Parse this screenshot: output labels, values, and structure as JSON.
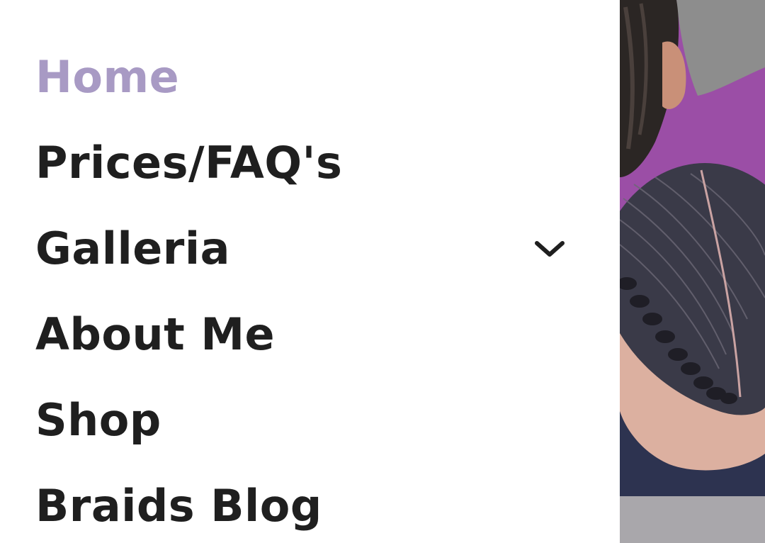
{
  "nav": {
    "items": [
      {
        "label": "Home",
        "active": true
      },
      {
        "label": "Prices/FAQ's"
      },
      {
        "label": "Galleria",
        "has_submenu": true
      },
      {
        "label": "About Me"
      },
      {
        "label": "Shop"
      },
      {
        "label": "Braids Blog"
      }
    ],
    "submenu_icon": "chevron-down-icon"
  },
  "colors": {
    "active": "#a89ac4",
    "text": "#1f1f1f",
    "background": "#ffffff",
    "photo_background": "#9b4ea6",
    "footer_bar": "#a9a7ab"
  }
}
